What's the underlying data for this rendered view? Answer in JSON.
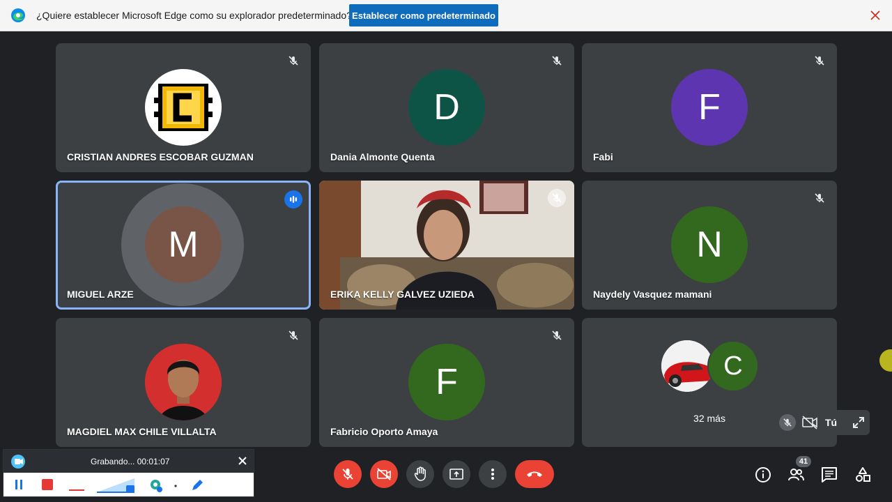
{
  "infobar": {
    "text": "¿Quiere establecer Microsoft Edge como su explorador predeterminado?",
    "button": "Establecer como predeterminado"
  },
  "tiles": [
    {
      "name": "CRISTIAN ANDRES ESCOBAR GUZMAN",
      "avatar": "image",
      "mic": "off"
    },
    {
      "name": "Dania Almonte Quenta",
      "avatar_letter": "D",
      "avatar_color": "#0d5446",
      "mic": "off"
    },
    {
      "name": "Fabi",
      "avatar_letter": "F",
      "avatar_color": "#5e35b1",
      "mic": "off"
    },
    {
      "name": "MIGUEL ARZE",
      "avatar_letter": "M",
      "avatar_color": "#795548",
      "mic": "speaking"
    },
    {
      "name": "ERIKA KELLY GALVEZ UZIEDA",
      "avatar": "video",
      "mic": "off"
    },
    {
      "name": "Naydely Vasquez mamani",
      "avatar_letter": "N",
      "avatar_color": "#33691e",
      "mic": "off"
    },
    {
      "name": "MAGDIEL MAX CHILE VILLALTA",
      "avatar": "photo",
      "mic": "off"
    },
    {
      "name": "Fabricio Oporto Amaya",
      "avatar_letter": "F",
      "avatar_color": "#33691e",
      "mic": "off"
    },
    {
      "more_label": "32 más",
      "avatar_letter": "C",
      "avatar_color": "#33691e"
    }
  ],
  "self_view": {
    "label": "Tú"
  },
  "recorder": {
    "status": "Grabando... 00:01:07"
  },
  "participants_count": "41",
  "colors": {
    "hangup": "#ea4335",
    "accent": "#1a73e8",
    "bg": "#202124",
    "tile": "#3c4043"
  }
}
